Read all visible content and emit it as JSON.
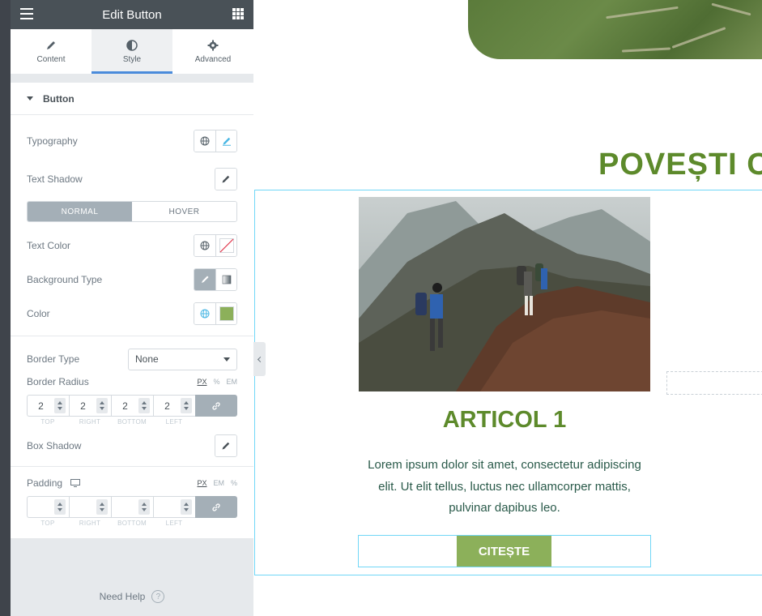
{
  "panel": {
    "title": "Edit Button",
    "tabs": [
      {
        "label": "Content",
        "icon": "pencil-icon"
      },
      {
        "label": "Style",
        "icon": "contrast-icon"
      },
      {
        "label": "Advanced",
        "icon": "gear-icon"
      }
    ],
    "active_tab": "Style",
    "section_title": "Button",
    "typography_label": "Typography",
    "text_shadow_label": "Text Shadow",
    "state_tabs": [
      "NORMAL",
      "HOVER"
    ],
    "active_state": "NORMAL",
    "text_color_label": "Text Color",
    "bg_type_label": "Background Type",
    "color_label": "Color",
    "color_value": "#8cb05a",
    "border_type_label": "Border Type",
    "border_type_value": "None",
    "border_radius_label": "Border Radius",
    "units": [
      "PX",
      "%",
      "EM"
    ],
    "border_radius_values": [
      "2",
      "2",
      "2",
      "2"
    ],
    "dim_labels": [
      "TOP",
      "RIGHT",
      "BOTTOM",
      "LEFT"
    ],
    "box_shadow_label": "Box Shadow",
    "padding_label": "Padding",
    "padding_units": [
      "PX",
      "EM",
      "%"
    ],
    "need_help": "Need Help"
  },
  "canvas": {
    "heading": "POVEȘTI C",
    "article_title": "ARTICOL 1",
    "article_text": "Lorem ipsum dolor sit amet, consectetur adipiscing elit. Ut elit tellus, luctus nec ullamcorper mattis, pulvinar dapibus leo.",
    "button_label": "CITEȘTE"
  },
  "colors": {
    "accent_green": "#5d8a2b",
    "button_green": "#8cb05a",
    "selection_blue": "#71d7f7",
    "panel_bg": "#e6e9ec"
  }
}
